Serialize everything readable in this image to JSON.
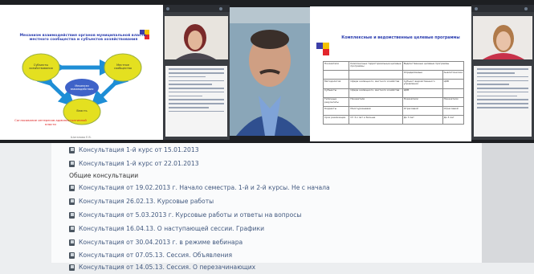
{
  "slide_left": {
    "title": "Механизм взаимодействия органов муниципальной власти, местного сообщества и субъектов хозяйствования",
    "caption": "Согласование интересов административной власти",
    "nodes": [
      {
        "label": "Субъекты хозяйствования"
      },
      {
        "label": "Местное сообщество"
      },
      {
        "label": "Механизм взаимодействия"
      },
      {
        "label": "Власть"
      }
    ],
    "footer": "Шиганова Е.В."
  },
  "slide_right": {
    "title": "Комплексные и ведомственные целевые программы",
    "table": {
      "header": [
        "Показатели",
        "Комплексные территориальные целевые программы",
        "Ведомственные целевые программы",
        ""
      ],
      "subheader": [
        "",
        "",
        "Определяемые",
        "Аналитические"
      ],
      "rows": [
        [
          "Методология",
          "Сфера жилищного, местного хозяйства",
          "Субъект ведомственного управления",
          "ЦКВ"
        ],
        [
          "Субъекты",
          "Сфера жилищного, местного хозяйства",
          "ЦКВ",
          ""
        ],
        [
          "Типичные результаты",
          "Показатели",
          "Показатели",
          "Показатели"
        ],
        [
          "Корректы",
          "Многоуровневая",
          "Отраслевой",
          "Отраслевой"
        ],
        [
          "Срок реализации",
          "От 3-х лет и больше",
          "До 3 лет",
          "До 3 лет"
        ]
      ]
    }
  },
  "webcams": {
    "left_participant": "participant-woman-1",
    "right_participant": "participant-woman-2",
    "speaker": "speaker-man"
  },
  "doc": {
    "items": [
      {
        "text": "Консультация 1-й курс от 15.01.2013",
        "type": "link"
      },
      {
        "text": "Консультация 1-й курс от 22.01.2013",
        "type": "link"
      },
      {
        "text": "Общие консультации",
        "type": "heading"
      },
      {
        "text": "Консультация от 19.02.2013 г. Начало семестра. 1-й и 2-й курсы. Не с начала",
        "type": "link"
      },
      {
        "text": "Консультация 26.02.13. Курсовые работы",
        "type": "link"
      },
      {
        "text": "Консультация от 5.03.2013 г. Курсовые работы и ответы на вопросы",
        "type": "link"
      },
      {
        "text": "Консультация 16.04.13. О наступающей сессии. Графики",
        "type": "link"
      },
      {
        "text": "Консультация от 30.04.2013 г. в режиме вебинара",
        "type": "link"
      },
      {
        "text": "Консультация от 07.05.13. Сессия. Объявления",
        "type": "link"
      },
      {
        "text": "Консультация от 14.05.13. Сессия. О перезачинающих",
        "type": "link"
      }
    ]
  },
  "colors": {
    "link": "#42597f",
    "slide_blue": "#2d3fb0",
    "node_yellow": "#e4e020",
    "arrow_blue": "#1e8ed6"
  }
}
